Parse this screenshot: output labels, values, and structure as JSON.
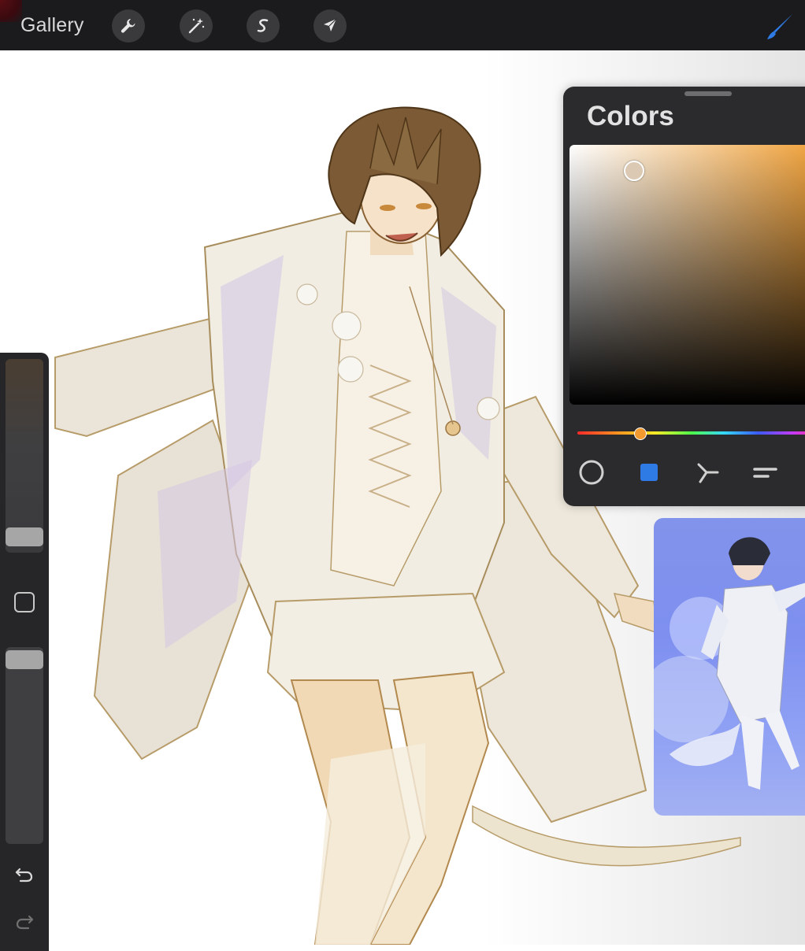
{
  "topbar": {
    "gallery_label": "Gallery",
    "tools": [
      {
        "icon": "wrench-icon",
        "name": "actions"
      },
      {
        "icon": "magic-wand-icon",
        "name": "adjustments"
      },
      {
        "icon": "selection-s-icon",
        "name": "selection"
      },
      {
        "icon": "arrow-cursor-icon",
        "name": "transform"
      }
    ],
    "active_tool_icon": "brush-icon",
    "active_tool_color": "#2f7be6"
  },
  "sidebar": {
    "size_level": 0.1,
    "opacity_level": 0.95,
    "undo_icon": "undo-icon",
    "redo_icon": "redo-icon",
    "modify_icon": "square-outline-icon"
  },
  "colors_panel": {
    "title": "Colors",
    "hue_color": "#f0a23c",
    "selected_color": "#dcc9b3",
    "modes": [
      {
        "icon": "disc-icon",
        "active": false
      },
      {
        "icon": "classic-square-icon",
        "active": true
      },
      {
        "icon": "harmony-icon",
        "active": false
      },
      {
        "icon": "value-lines-icon",
        "active": false
      }
    ]
  },
  "reference": {
    "description_icon": "reference-image-icon"
  }
}
